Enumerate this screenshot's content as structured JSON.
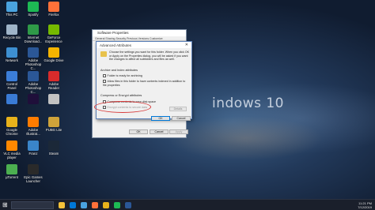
{
  "desktop": {
    "watermark": "indows 10",
    "icons": [
      {
        "label": "This PC",
        "color": "#4aa3df"
      },
      {
        "label": "Spotify",
        "color": "#1db954"
      },
      {
        "label": "Firefox",
        "color": "#ff7139"
      },
      {
        "label": "Recycle Bin",
        "color": "#9fb4c8"
      },
      {
        "label": "Internet\nDownload...",
        "color": "#2f9a48"
      },
      {
        "label": "GeForce\nExperience",
        "color": "#76b900"
      },
      {
        "label": "Network",
        "color": "#3d8fd1"
      },
      {
        "label": "Adobe\nPhotoshop C...",
        "color": "#2b5797"
      },
      {
        "label": "Google Drive",
        "color": "#f4b400"
      },
      {
        "label": "Control Panel",
        "color": "#3b7dd8"
      },
      {
        "label": "Adobe\nPhotoshop C...",
        "color": "#2b5797"
      },
      {
        "label": "Adobe\nReader",
        "color": "#d92b2b"
      },
      {
        "label": "",
        "color": "#3a7bd5"
      },
      {
        "label": "",
        "color": "#1f0f3a"
      },
      {
        "label": "",
        "color": "#c2c2c2"
      },
      {
        "label": "Google\nChrome",
        "color": "#e8b21b"
      },
      {
        "label": "Adobe\nIllustrat...",
        "color": "#ff7c00"
      },
      {
        "label": "PUBG Lite",
        "color": "#cfa33a"
      },
      {
        "label": "VLC media\nplayer",
        "color": "#ff8800"
      },
      {
        "label": "Franz",
        "color": "#3a85c9"
      },
      {
        "label": "Steam",
        "color": "#1b2838"
      },
      {
        "label": "µTorrent",
        "color": "#4caf50"
      },
      {
        "label": "Epic Games\nLauncher",
        "color": "#2a2a2a"
      }
    ]
  },
  "properties_dialog": {
    "title": "Software Properties",
    "tabs": "General  Sharing  Security  Previous Versions  Customize",
    "ok": "OK",
    "cancel": "Cancel",
    "apply": "Apply"
  },
  "advanced_attributes": {
    "title": "Advanced Attributes",
    "close": "✕",
    "intro": "Choose the settings you want for this folder. When you click OK or Apply on the Properties dialog, you will be asked if you want the changes to affect all subfolders and files as well.",
    "archive_section": "Archive and Index attributes",
    "archive_check": "Folder is ready for archiving",
    "index_check": "Allow files in this folder to have contents indexed in addition to file properties",
    "compress_section": "Compress or Encrypt attributes",
    "compress_check": "Compress contents to save disk space",
    "encrypt_check": "Encrypt contents to secure data",
    "details": "Details",
    "ok": "OK",
    "cancel": "Cancel"
  },
  "taskbar": {
    "time": "11:21 PM",
    "date": "7/12/2019"
  }
}
